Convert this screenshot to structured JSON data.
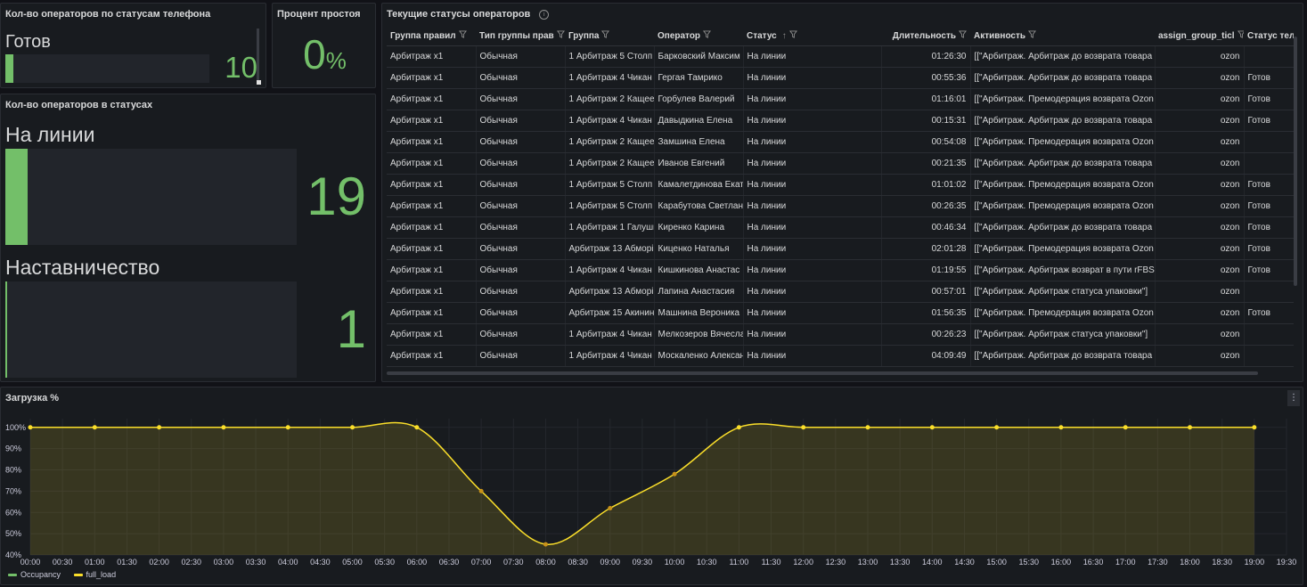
{
  "panel_ready": {
    "title": "Кол-во операторов по статусам телефона",
    "name": "Готов",
    "value": "10",
    "fraction": 0.04
  },
  "panel_idle": {
    "title": "Процент простоя",
    "value": "0",
    "unit": "%"
  },
  "panel_statuses": {
    "title": "Кол-во операторов в статусах",
    "items": [
      {
        "name": "На линии",
        "value": "19",
        "fraction": 0.075
      },
      {
        "name": "Наставничество",
        "value": "1",
        "fraction": 0.006
      }
    ]
  },
  "table": {
    "title": "Текущие статусы операторов",
    "columns": [
      "Группа правил",
      "Тип группы прав",
      "Группа",
      "Оператор",
      "Статус",
      "Длительность",
      "Активность",
      "assign_group_ticl",
      "Статус теле"
    ],
    "sort_indicator": "↑",
    "rows": [
      [
        "Арбитраж x1",
        "Обычная",
        "1 Арбитраж 5 Столп",
        "Барковский Максим",
        "На линии",
        "01:26:30",
        "[[\"Арбитраж. Арбитраж до возврата товара",
        "ozon",
        ""
      ],
      [
        "Арбитраж x1",
        "Обычная",
        "1 Арбитраж 4 Чикан",
        "Гергая Тамрико",
        "На линии",
        "00:55:36",
        "[[\"Арбитраж. Арбитраж до возврата товара",
        "ozon",
        "Готов"
      ],
      [
        "Арбитраж x1",
        "Обычная",
        "1 Арбитраж 2 Кащее",
        "Горбулев Валерий",
        "На линии",
        "01:16:01",
        "[[\"Арбитраж. Премодерация возврата Ozon",
        "ozon",
        "Готов"
      ],
      [
        "Арбитраж x1",
        "Обычная",
        "1 Арбитраж 4 Чикан",
        "Давыдкина Елена",
        "На линии",
        "00:15:31",
        "[[\"Арбитраж. Арбитраж до возврата товара",
        "ozon",
        "Готов"
      ],
      [
        "Арбитраж x1",
        "Обычная",
        "1 Арбитраж 2 Кащее",
        "Замшина Елена",
        "На линии",
        "00:54:08",
        "[[\"Арбитраж. Премодерация возврата Ozon",
        "ozon",
        ""
      ],
      [
        "Арбитраж x1",
        "Обычная",
        "1 Арбитраж 2 Кащее",
        "Иванов Евгений",
        "На линии",
        "00:21:35",
        "[[\"Арбитраж. Арбитраж до возврата товара",
        "ozon",
        ""
      ],
      [
        "Арбитраж x1",
        "Обычная",
        "1 Арбитраж 5 Столп",
        "Камалетдинова Екат",
        "На линии",
        "01:01:02",
        "[[\"Арбитраж. Премодерация возврата Ozon",
        "ozon",
        "Готов"
      ],
      [
        "Арбитраж x1",
        "Обычная",
        "1 Арбитраж 5 Столп",
        "Карабутова Светлан",
        "На линии",
        "00:26:35",
        "[[\"Арбитраж. Премодерация возврата Ozon",
        "ozon",
        "Готов"
      ],
      [
        "Арбитраж x1",
        "Обычная",
        "1 Арбитраж 1 Галуши",
        "Киренко Карина",
        "На линии",
        "00:46:34",
        "[[\"Арбитраж. Арбитраж до возврата товара",
        "ozon",
        "Готов"
      ],
      [
        "Арбитраж x1",
        "Обычная",
        "Арбитраж 13 Абморі",
        "Киценко Наталья",
        "На линии",
        "02:01:28",
        "[[\"Арбитраж. Премодерация возврата Ozon",
        "ozon",
        "Готов"
      ],
      [
        "Арбитраж x1",
        "Обычная",
        "1 Арбитраж 4 Чикан",
        "Кишкинова Анастас",
        "На линии",
        "01:19:55",
        "[[\"Арбитраж. Арбитраж возврат в пути rFBS",
        "ozon",
        "Готов"
      ],
      [
        "Арбитраж x1",
        "Обычная",
        "Арбитраж 13 Абморі",
        "Лапина Анастасия",
        "На линии",
        "00:57:01",
        "[[\"Арбитраж. Арбитраж статуса упаковки\"]",
        "ozon",
        ""
      ],
      [
        "Арбитраж x1",
        "Обычная",
        "Арбитраж 15 Акинин",
        "Машнина Вероника",
        "На линии",
        "01:56:35",
        "[[\"Арбитраж. Премодерация возврата Ozon",
        "ozon",
        "Готов"
      ],
      [
        "Арбитраж x1",
        "Обычная",
        "1 Арбитраж 4 Чикан",
        "Мелкозеров Вячесла",
        "На линии",
        "00:26:23",
        "[[\"Арбитраж. Арбитраж статуса упаковки\"]",
        "ozon",
        ""
      ],
      [
        "Арбитраж x1",
        "Обычная",
        "1 Арбитраж 4 Чикан",
        "Москаленко Алексан",
        "На линии",
        "04:09:49",
        "[[\"Арбитраж. Арбитраж до возврата товара",
        "ozon",
        ""
      ]
    ]
  },
  "chart_data": {
    "type": "line",
    "title": "Загрузка %",
    "xlabel": "",
    "ylabel": "",
    "x_ticks": [
      "00:00",
      "00:30",
      "01:00",
      "01:30",
      "02:00",
      "02:30",
      "03:00",
      "03:30",
      "04:00",
      "04:30",
      "05:00",
      "05:30",
      "06:00",
      "06:30",
      "07:00",
      "07:30",
      "08:00",
      "08:30",
      "09:00",
      "09:30",
      "10:00",
      "10:30",
      "11:00",
      "11:30",
      "12:00",
      "12:30",
      "13:00",
      "13:30",
      "14:00",
      "14:30",
      "15:00",
      "15:30",
      "16:00",
      "16:30",
      "17:00",
      "17:30",
      "18:00",
      "18:30",
      "19:00",
      "19:30"
    ],
    "y_ticks": [
      "40%",
      "50%",
      "60%",
      "70%",
      "80%",
      "90%",
      "100%"
    ],
    "ylim": [
      40,
      102
    ],
    "xlim": [
      0,
      19.5
    ],
    "grid": true,
    "legend_placement": "bottom-left",
    "series": [
      {
        "name": "Occupancy",
        "color": "#73bf69",
        "x": [],
        "values": []
      },
      {
        "name": "full_load",
        "color": "#fade2a",
        "x": [
          0,
          1,
          2,
          3,
          4,
          5,
          6,
          7,
          8,
          9,
          10,
          11,
          12,
          13,
          14,
          15,
          16,
          17,
          18,
          19
        ],
        "values": [
          100,
          100,
          100,
          100,
          100,
          100,
          100,
          70,
          45,
          62,
          78,
          100,
          100,
          100,
          100,
          100,
          100,
          100,
          100,
          100
        ]
      }
    ]
  }
}
